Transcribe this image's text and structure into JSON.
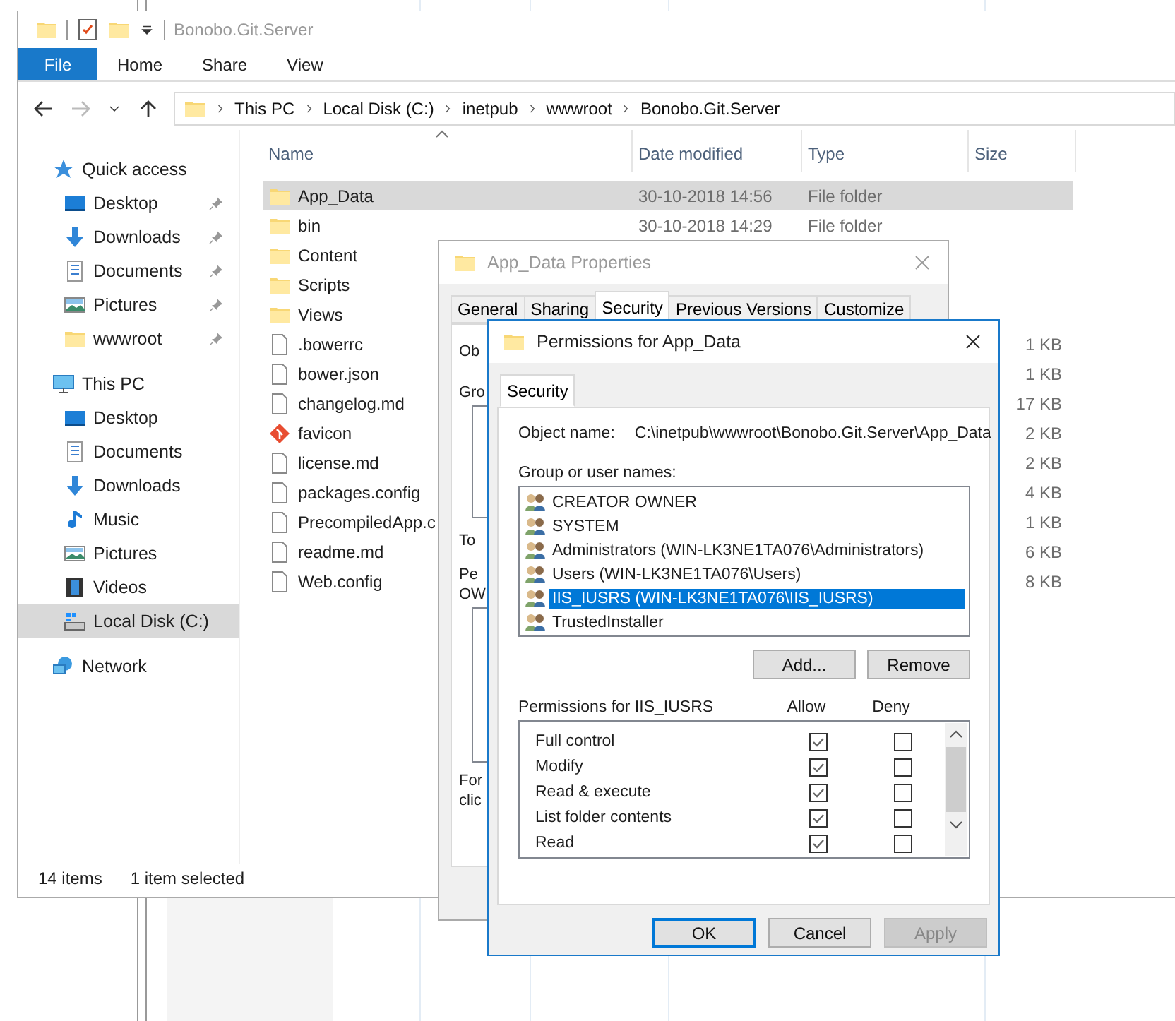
{
  "explorer": {
    "title": "Bonobo.Git.Server",
    "file_tab": "File",
    "ribbon_tabs": [
      "Home",
      "Share",
      "View"
    ],
    "breadcrumb": [
      "This PC",
      "Local Disk (C:)",
      "inetpub",
      "wwwroot",
      "Bonobo.Git.Server"
    ],
    "nav": [
      {
        "label": "Quick access",
        "kind": "star",
        "selected": false,
        "children": [
          {
            "label": "Desktop",
            "kind": "desktop",
            "pinned": true,
            "selected": false
          },
          {
            "label": "Downloads",
            "kind": "downloads",
            "pinned": true,
            "selected": false
          },
          {
            "label": "Documents",
            "kind": "documents",
            "pinned": true,
            "selected": false
          },
          {
            "label": "Pictures",
            "kind": "pictures",
            "pinned": true,
            "selected": false
          },
          {
            "label": "wwwroot",
            "kind": "folder",
            "pinned": true,
            "selected": false
          }
        ]
      },
      {
        "label": "This PC",
        "kind": "pc",
        "selected": false,
        "children": [
          {
            "label": "Desktop",
            "kind": "desktop",
            "pinned": false,
            "selected": false
          },
          {
            "label": "Documents",
            "kind": "documents",
            "pinned": false,
            "selected": false
          },
          {
            "label": "Downloads",
            "kind": "downloads",
            "pinned": false,
            "selected": false
          },
          {
            "label": "Music",
            "kind": "music",
            "pinned": false,
            "selected": false
          },
          {
            "label": "Pictures",
            "kind": "pictures",
            "pinned": false,
            "selected": false
          },
          {
            "label": "Videos",
            "kind": "videos",
            "pinned": false,
            "selected": false
          },
          {
            "label": "Local Disk (C:)",
            "kind": "drive",
            "pinned": false,
            "selected": true
          }
        ]
      },
      {
        "label": "Network",
        "kind": "network",
        "selected": false
      }
    ],
    "columns": [
      {
        "label": "Name",
        "sorted": true
      },
      {
        "label": "Date modified",
        "sorted": false
      },
      {
        "label": "Type",
        "sorted": false
      },
      {
        "label": "Size",
        "sorted": false
      }
    ],
    "files": [
      {
        "name": "App_Data",
        "kind": "folder",
        "date": "30-10-2018 14:56",
        "type": "File folder",
        "selected": true
      },
      {
        "name": "bin",
        "kind": "folder",
        "date": "30-10-2018 14:29",
        "type": "File folder",
        "selected": false
      },
      {
        "name": "Content",
        "kind": "folder",
        "selected": false
      },
      {
        "name": "Scripts",
        "kind": "folder",
        "selected": false
      },
      {
        "name": "Views",
        "kind": "folder",
        "selected": false
      },
      {
        "name": ".bowerrc",
        "kind": "file",
        "size": "1 KB",
        "selected": false
      },
      {
        "name": "bower.json",
        "kind": "file",
        "size": "1 KB",
        "selected": false
      },
      {
        "name": "changelog.md",
        "kind": "file",
        "size": "17 KB",
        "selected": false
      },
      {
        "name": "favicon",
        "kind": "git",
        "size": "2 KB",
        "selected": false
      },
      {
        "name": "license.md",
        "kind": "file",
        "size": "2 KB",
        "selected": false
      },
      {
        "name": "packages.config",
        "kind": "file",
        "size": "4 KB",
        "selected": false
      },
      {
        "name": "PrecompiledApp.c",
        "kind": "file",
        "size": "1 KB",
        "selected": false
      },
      {
        "name": "readme.md",
        "kind": "file",
        "size": "6 KB",
        "selected": false
      },
      {
        "name": "Web.config",
        "kind": "file",
        "size": "8 KB",
        "selected": false
      }
    ],
    "status": [
      "14 items",
      "1 item selected"
    ]
  },
  "properties": {
    "title": "App_Data Properties",
    "tabs": [
      {
        "label": "General",
        "selected": false
      },
      {
        "label": "Sharing",
        "selected": false
      },
      {
        "label": "Security",
        "selected": true
      },
      {
        "label": "Previous Versions",
        "selected": false
      },
      {
        "label": "Customize",
        "selected": false
      }
    ],
    "fragments": [
      "Ob",
      "Gro",
      "To",
      "Pe",
      "OW",
      "For",
      "clic"
    ]
  },
  "permissions": {
    "title": "Permissions for App_Data",
    "tab": "Security",
    "object_label": "Object name:",
    "object_value": "C:\\inetpub\\wwwroot\\Bonobo.Git.Server\\App_Data",
    "group_label": "Group or user names:",
    "users": [
      {
        "name": "CREATOR OWNER",
        "selected": false
      },
      {
        "name": "SYSTEM",
        "selected": false
      },
      {
        "name": "Administrators (WIN-LK3NE1TA076\\Administrators)",
        "selected": false
      },
      {
        "name": "Users (WIN-LK3NE1TA076\\Users)",
        "selected": false
      },
      {
        "name": "IIS_IUSRS (WIN-LK3NE1TA076\\IIS_IUSRS)",
        "selected": true
      },
      {
        "name": "TrustedInstaller",
        "selected": false
      }
    ],
    "add_button": "Add...",
    "remove_button": "Remove",
    "perm_label": "Permissions for IIS_IUSRS",
    "allow_label": "Allow",
    "deny_label": "Deny",
    "perms": [
      {
        "name": "Full control",
        "allow": true,
        "deny": false
      },
      {
        "name": "Modify",
        "allow": true,
        "deny": false
      },
      {
        "name": "Read & execute",
        "allow": true,
        "deny": false
      },
      {
        "name": "List folder contents",
        "allow": true,
        "deny": false
      },
      {
        "name": "Read",
        "allow": true,
        "deny": false
      }
    ],
    "buttons": [
      {
        "label": "OK",
        "kind": "default"
      },
      {
        "label": "Cancel",
        "kind": "normal"
      },
      {
        "label": "Apply",
        "kind": "disabled"
      }
    ]
  }
}
